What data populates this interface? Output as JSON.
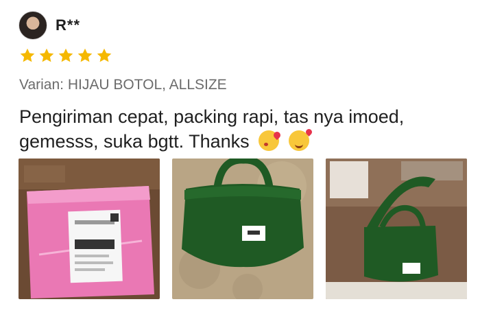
{
  "review": {
    "username": "R**",
    "rating": 5,
    "variant": "Varian: HIJAU BOTOL, ALLSIZE",
    "text": "Pengiriman cepat, packing rapi,  tas nya imoed, gemesss, suka bgtt. Thanks",
    "emojis": [
      "kissing-heart-emoji",
      "smiling-hearts-emoji"
    ]
  },
  "photos": [
    {
      "name": "pink-package-photo"
    },
    {
      "name": "green-bag-photo"
    },
    {
      "name": "green-bag-strap-photo"
    }
  ],
  "colors": {
    "star": "#f5b800",
    "variant_text": "#6b6b6b",
    "bag_green": "#1f5a24",
    "package_pink": "#ea78b4"
  }
}
